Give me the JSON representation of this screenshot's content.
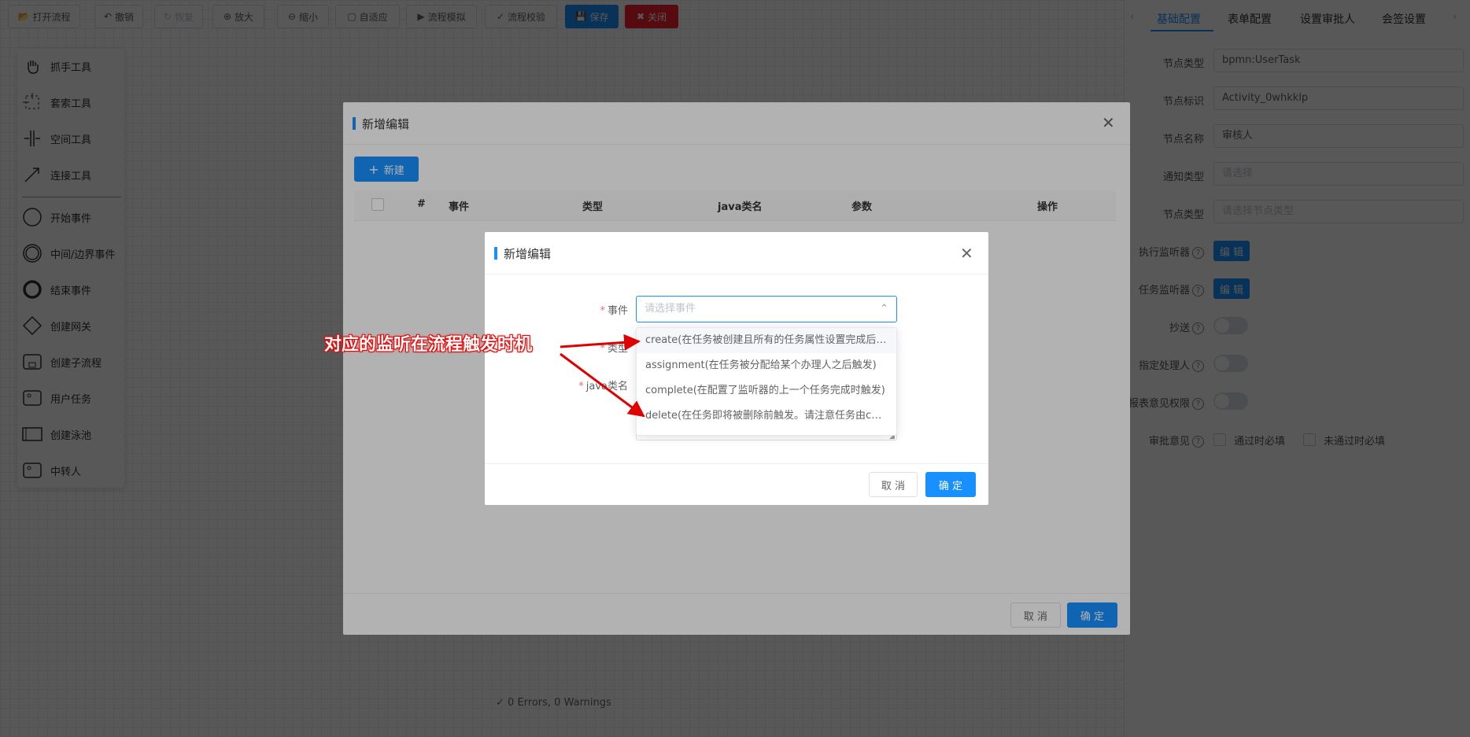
{
  "toolbar": {
    "buttons": [
      {
        "label": "打开流程",
        "icon": "folder-open-icon"
      },
      {
        "label": "撤销",
        "icon": "undo-icon"
      },
      {
        "label": "恢复",
        "icon": "redo-icon"
      },
      {
        "label": "放大",
        "icon": "zoom-in-icon"
      },
      {
        "label": "缩小",
        "icon": "zoom-out-icon"
      },
      {
        "label": "自适应",
        "icon": "fit-icon"
      },
      {
        "label": "流程模拟",
        "icon": "play-icon"
      },
      {
        "label": "流程校验",
        "icon": "validate-icon"
      },
      {
        "label": "保存",
        "icon": "save-icon"
      },
      {
        "label": "关闭",
        "icon": "close-icon"
      }
    ]
  },
  "palette": {
    "items": [
      {
        "label": "抓手工具",
        "icon": "hand-tool-icon"
      },
      {
        "label": "套索工具",
        "icon": "lasso-tool-icon"
      },
      {
        "label": "空间工具",
        "icon": "space-tool-icon"
      },
      {
        "label": "连接工具",
        "icon": "connect-tool-icon"
      },
      {
        "label": "开始事件",
        "icon": "start-event-icon"
      },
      {
        "label": "中间/边界事件",
        "icon": "intermediate-event-icon"
      },
      {
        "label": "结束事件",
        "icon": "end-event-icon"
      },
      {
        "label": "创建网关",
        "icon": "gateway-icon"
      },
      {
        "label": "创建子流程",
        "icon": "subprocess-icon"
      },
      {
        "label": "用户任务",
        "icon": "user-task-icon"
      },
      {
        "label": "创建泳池",
        "icon": "pool-icon"
      },
      {
        "label": "中转人",
        "icon": "relay-icon"
      }
    ]
  },
  "status": {
    "text": "0 Errors, 0 Warnings"
  },
  "right_panel": {
    "tabs": [
      "基础配置",
      "表单配置",
      "设置审批人",
      "会签设置"
    ],
    "active_tab": "基础配置",
    "fields": {
      "node_type_label": "节点类型",
      "node_type_value": "bpmn:UserTask",
      "node_id_label": "节点标识",
      "node_id_value": "Activity_0whkklp",
      "node_name_label": "节点名称",
      "node_name_value": "审核人",
      "notify_type_label": "通知类型",
      "notify_type_placeholder": "请选择",
      "node_type2_label": "节点类型",
      "node_type2_placeholder": "请选择节点类型",
      "exec_listener_label": "执行监听器",
      "task_listener_label": "任务监听器",
      "edit_label": "编 辑",
      "cc_label": "抄送",
      "assignee_label": "指定处理人",
      "form_perm_label": "报表意见权限",
      "opinion_label": "审批意见",
      "pass_required": "通过时必填",
      "fail_required": "未通过时必填"
    }
  },
  "outer_dialog": {
    "title": "新增编辑",
    "new_button": "新建",
    "columns": [
      "#",
      "事件",
      "类型",
      "java类名",
      "参数",
      "操作"
    ],
    "cancel": "取 消",
    "confirm": "确 定"
  },
  "inner_dialog": {
    "title": "新增编辑",
    "event_label": "事件",
    "event_placeholder": "请选择事件",
    "type_label": "类型",
    "java_label": "java类名",
    "cancel": "取 消",
    "confirm": "确 定",
    "options": [
      "create(在任务被创建且所有的任务属性设置完成后才触发)",
      "assignment(在任务被分配给某个办理人之后触发)",
      "complete(在配置了监听器的上一个任务完成时触发)",
      "delete(在任务即将被删除前触发。请注意任务由completeTask正常完成时也会触发)"
    ]
  },
  "annotation": {
    "text": "对应的监听在流程触发时机",
    "color": "#e00000"
  },
  "colors": {
    "primary": "#1890ff",
    "danger": "#f5222d",
    "annotation": "#e00000"
  }
}
